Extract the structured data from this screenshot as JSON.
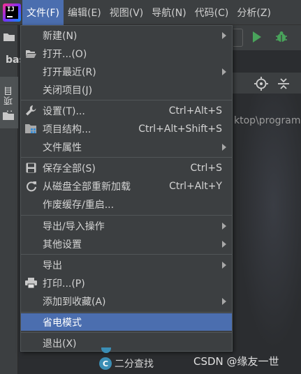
{
  "menubar": {
    "logo_text": "IJ",
    "items": [
      {
        "label": "文件(F)",
        "active": true
      },
      {
        "label": "编辑(E)"
      },
      {
        "label": "视图(V)"
      },
      {
        "label": "导航(N)"
      },
      {
        "label": "代码(C)"
      },
      {
        "label": "分析(Z)"
      }
    ]
  },
  "left_strip": {
    "project_tab": "1: 项目",
    "partial_title": "bas"
  },
  "editor": {
    "path_fragment": "ktop\\program"
  },
  "file_menu": {
    "items": [
      {
        "label": "新建(N)",
        "icon": "",
        "shortcut": "",
        "submenu": true
      },
      {
        "label": "打开...(O)",
        "icon": "folder-open-icon",
        "shortcut": "",
        "submenu": false
      },
      {
        "label": "打开最近(R)",
        "icon": "",
        "shortcut": "",
        "submenu": true
      },
      {
        "label": "关闭项目(J)",
        "icon": "",
        "shortcut": "",
        "submenu": false
      },
      {
        "label": "设置(T)...",
        "icon": "wrench-icon",
        "shortcut": "Ctrl+Alt+S",
        "submenu": false
      },
      {
        "label": "项目结构...",
        "icon": "project-structure-icon",
        "shortcut": "Ctrl+Alt+Shift+S",
        "submenu": false
      },
      {
        "label": "文件属性",
        "icon": "",
        "shortcut": "",
        "submenu": true
      },
      {
        "label": "保存全部(S)",
        "icon": "save-icon",
        "shortcut": "Ctrl+S",
        "submenu": false
      },
      {
        "label": "从磁盘全部重新加载",
        "icon": "reload-icon",
        "shortcut": "Ctrl+Alt+Y",
        "submenu": false
      },
      {
        "label": "作废缓存/重启...",
        "icon": "",
        "shortcut": "",
        "submenu": false
      },
      {
        "label": "导出/导入操作",
        "icon": "",
        "shortcut": "",
        "submenu": true
      },
      {
        "label": "其他设置",
        "icon": "",
        "shortcut": "",
        "submenu": true
      },
      {
        "label": "导出",
        "icon": "",
        "shortcut": "",
        "submenu": true
      },
      {
        "label": "打印...(P)",
        "icon": "printer-icon",
        "shortcut": "",
        "submenu": false
      },
      {
        "label": "添加到收藏(A)",
        "icon": "",
        "shortcut": "",
        "submenu": true
      },
      {
        "label": "省电模式",
        "icon": "",
        "shortcut": "",
        "submenu": false,
        "highlighted": true
      },
      {
        "label": "退出(X)",
        "icon": "",
        "shortcut": "",
        "submenu": false
      }
    ]
  },
  "bottom": {
    "tree_item_icon": "C",
    "tree_item_label": "二分查找",
    "watermark": "CSDN @缘友一世"
  },
  "colors": {
    "highlight": "#4b6eaf",
    "menu_bg": "#3c3f41",
    "run_green": "#49a35b"
  }
}
